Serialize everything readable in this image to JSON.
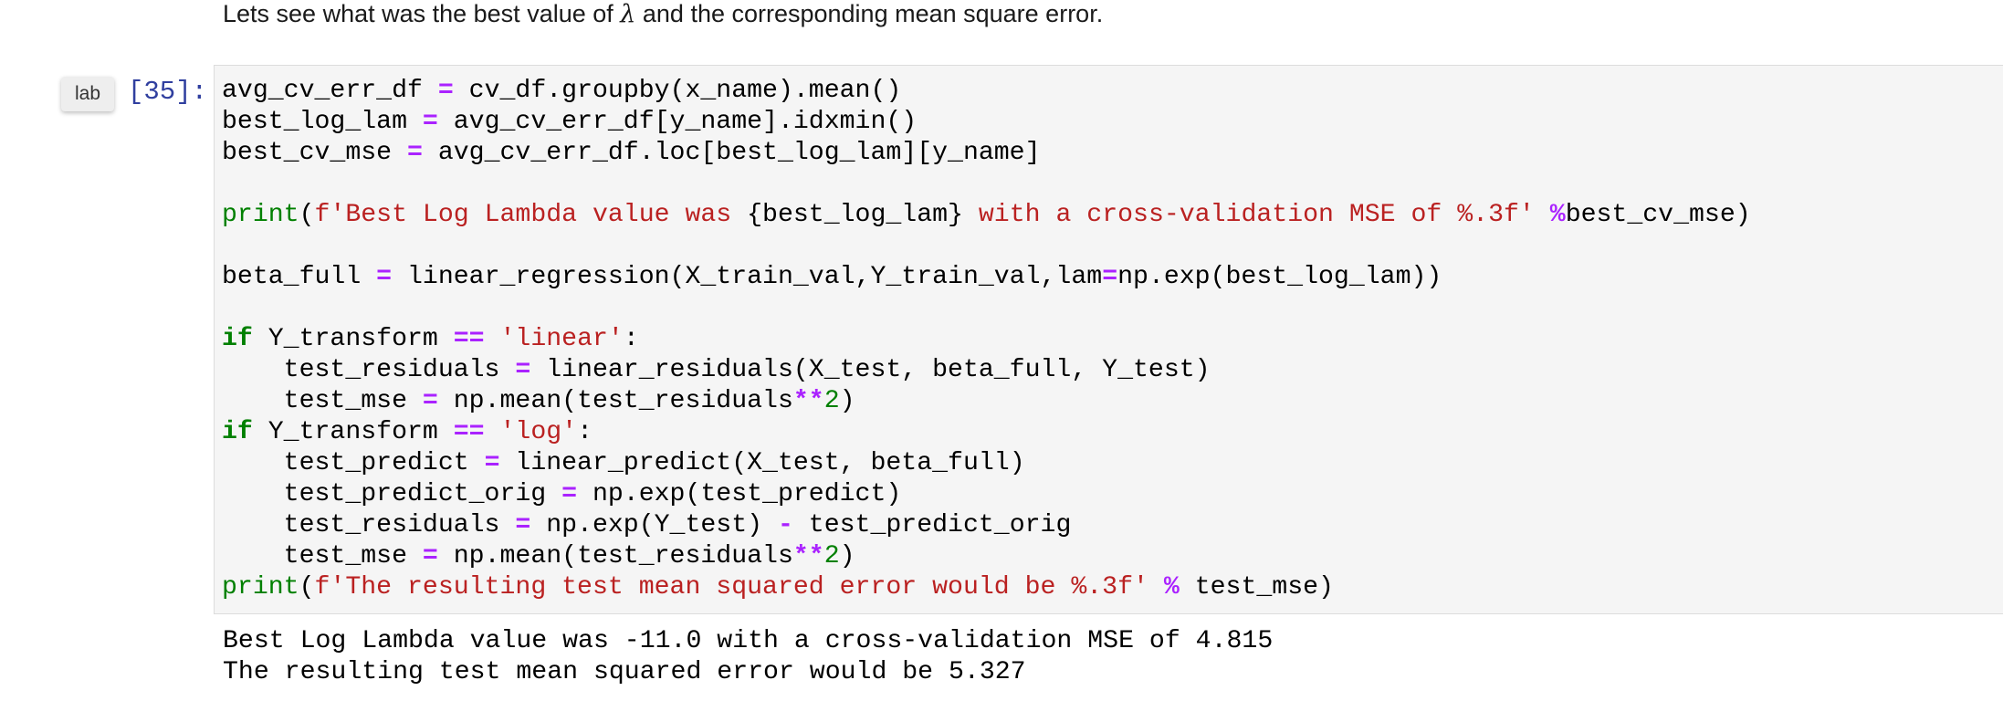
{
  "markdown": {
    "text_before": "Lets see what was the best value of ",
    "lambda_symbol": "λ",
    "text_after": " and the corresponding mean square error."
  },
  "cell": {
    "lab_tag": "lab",
    "prompt": "[35]:",
    "code_lines": [
      [
        "avg_cv_err_df ",
        "=",
        " cv_df.groupby(x_name).mean()"
      ],
      [
        "best_log_lam ",
        "=",
        " avg_cv_err_df[y_name].idxmin()"
      ],
      [
        "best_cv_mse ",
        "=",
        " avg_cv_err_df.loc[best_log_lam][y_name]"
      ],
      [
        ""
      ],
      [
        "print",
        "(",
        "f'Best Log Lambda value was ",
        "{best_log_lam}",
        " with a cross-validation MSE of %.3f'",
        " ",
        "%",
        "best_cv_mse)"
      ],
      [
        ""
      ],
      [
        "beta_full ",
        "=",
        " linear_regression(X_train_val,Y_train_val,lam",
        "=",
        "np.exp(best_log_lam))"
      ],
      [
        ""
      ],
      [
        "if",
        " Y_transform ",
        "==",
        " ",
        "'linear'",
        ":"
      ],
      [
        "    test_residuals ",
        "=",
        " linear_residuals(X_test, beta_full, Y_test)"
      ],
      [
        "    test_mse ",
        "=",
        " np.mean(test_residuals",
        "**",
        "2",
        ")"
      ],
      [
        "if",
        " Y_transform ",
        "==",
        " ",
        "'log'",
        ":"
      ],
      [
        "    test_predict ",
        "=",
        " linear_predict(X_test, beta_full)"
      ],
      [
        "    test_predict_orig ",
        "=",
        " np.exp(test_predict)"
      ],
      [
        "    test_residuals ",
        "=",
        " np.exp(Y_test) ",
        "-",
        " test_predict_orig"
      ],
      [
        "    test_mse ",
        "=",
        " np.mean(test_residuals",
        "**",
        "2",
        ")"
      ],
      [
        "print",
        "(",
        "f'The resulting test mean squared error would be %.3f'",
        " ",
        "%",
        " test_mse)"
      ]
    ],
    "code_classes": [
      [
        "",
        "op",
        ""
      ],
      [
        "",
        "op",
        ""
      ],
      [
        "",
        "op",
        ""
      ],
      [
        ""
      ],
      [
        "bi",
        "",
        "str",
        "",
        "str",
        "",
        "op",
        ""
      ],
      [
        ""
      ],
      [
        "",
        "op",
        "",
        "op",
        ""
      ],
      [
        ""
      ],
      [
        "kw",
        "",
        "op",
        "",
        "str",
        ""
      ],
      [
        "",
        "op",
        ""
      ],
      [
        "",
        "op",
        "",
        "op",
        "num",
        ""
      ],
      [
        "kw",
        "",
        "op",
        "",
        "str",
        ""
      ],
      [
        "",
        "op",
        ""
      ],
      [
        "",
        "op",
        ""
      ],
      [
        "",
        "op",
        "",
        "op",
        ""
      ],
      [
        "",
        "op",
        "",
        "op",
        "num",
        ""
      ],
      [
        "bi",
        "",
        "str",
        "",
        "op",
        ""
      ]
    ],
    "output_lines": [
      "Best Log Lambda value was -11.0 with a cross-validation MSE of 4.815",
      "The resulting test mean squared error would be 5.327"
    ]
  }
}
